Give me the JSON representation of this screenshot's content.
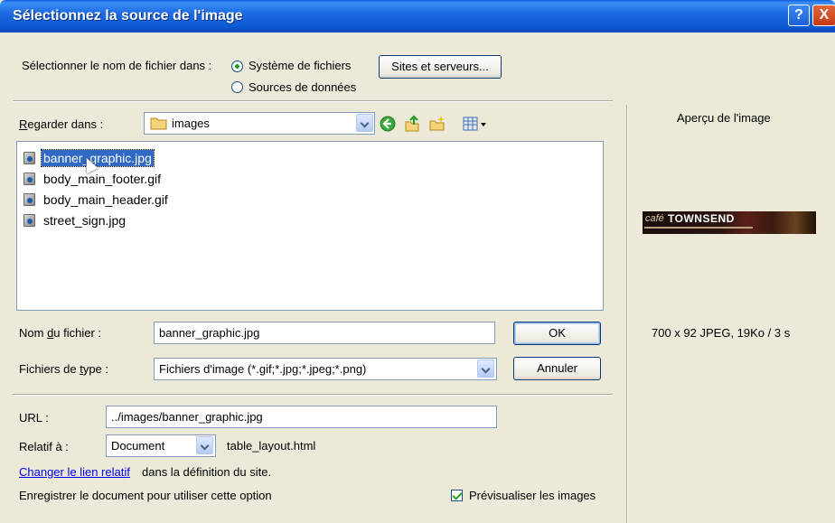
{
  "window": {
    "title": "Sélectionnez la source de l'image",
    "help_glyph": "?",
    "close_glyph": "X"
  },
  "source": {
    "label": "Sélectionner le nom de fichier dans :",
    "options": [
      "Système de fichiers",
      "Sources de données"
    ],
    "selected": "Système de fichiers",
    "sites_button": "Sites et serveurs..."
  },
  "lookin": {
    "label_prefix": "",
    "label_underlined": "R",
    "label_rest": "egarder dans :",
    "folder": "images"
  },
  "files": [
    {
      "name": "banner_graphic.jpg",
      "selected": true
    },
    {
      "name": "body_main_footer.gif",
      "selected": false
    },
    {
      "name": "body_main_header.gif",
      "selected": false
    },
    {
      "name": "street_sign.jpg",
      "selected": false
    }
  ],
  "filename": {
    "label_prefix": "Nom ",
    "label_underlined": "d",
    "label_rest": "u fichier :",
    "value": "banner_graphic.jpg",
    "ok_button": "OK"
  },
  "filetype": {
    "label_prefix": "Fichiers de ",
    "label_underlined": "t",
    "label_rest": "ype :",
    "value": "Fichiers d'image (*.gif;*.jpg;*.jpeg;*.png)",
    "cancel_button": "Annuler"
  },
  "url": {
    "label": "URL :",
    "value": "../images/banner_graphic.jpg"
  },
  "relative": {
    "label": "Relatif à :",
    "value": "Document",
    "file": "table_layout.html"
  },
  "change_link": {
    "link_text": "Changer le lien relatif",
    "rest": " dans la définition  du site."
  },
  "save_note": "Enregistrer le document pour utiliser cette option",
  "preview_checkbox": {
    "label": "Prévisualiser les images",
    "checked": true
  },
  "preview": {
    "heading": "Aperçu de l'image",
    "banner_brand_left": "café",
    "banner_brand_right": "TOWNSEND",
    "info": "700 x 92 JPEG,  19Ko / 3 s"
  },
  "colors": {
    "selection": "#316ac5",
    "titlebar": "#0b56d2",
    "dialog_bg": "#ece9d8"
  }
}
